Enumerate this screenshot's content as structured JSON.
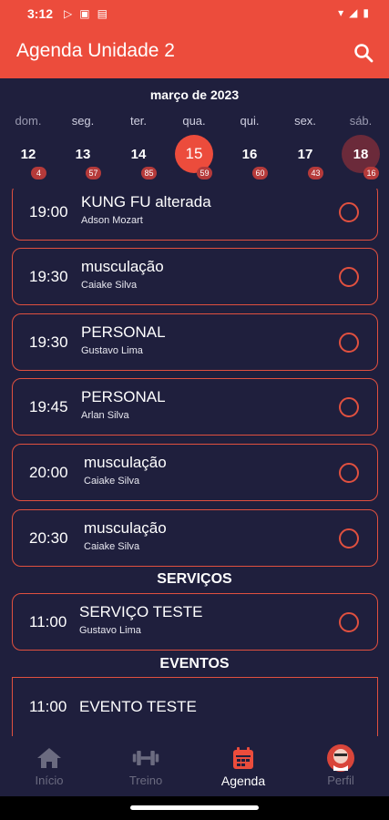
{
  "status_bar": {
    "time": "3:12"
  },
  "app_bar": {
    "title": "Agenda Unidade 2"
  },
  "calendar": {
    "month": "março de 2023",
    "days": [
      {
        "name": "dom.",
        "num": "12",
        "badge": "4",
        "state": "normal",
        "name_style": "faded"
      },
      {
        "name": "seg.",
        "num": "13",
        "badge": "57",
        "state": "normal",
        "name_style": "normal"
      },
      {
        "name": "ter.",
        "num": "14",
        "badge": "85",
        "state": "normal",
        "name_style": "normal"
      },
      {
        "name": "qua.",
        "num": "15",
        "badge": "59",
        "state": "today",
        "name_style": "normal"
      },
      {
        "name": "qui.",
        "num": "16",
        "badge": "60",
        "state": "normal",
        "name_style": "normal"
      },
      {
        "name": "sex.",
        "num": "17",
        "badge": "43",
        "state": "normal",
        "name_style": "normal"
      },
      {
        "name": "sáb.",
        "num": "18",
        "badge": "16",
        "state": "selected",
        "name_style": "faded"
      }
    ]
  },
  "appointments": [
    {
      "time": "19:00",
      "title": "KUNG FU alterada",
      "professional": "Adson Mozart"
    },
    {
      "time": "19:30",
      "title": "musculação",
      "professional": "Caiake Silva"
    },
    {
      "time": "19:30",
      "title": "PERSONAL",
      "professional": "Gustavo Lima"
    },
    {
      "time": "19:45",
      "title": "PERSONAL",
      "professional": "Arlan Silva"
    },
    {
      "time": "20:00",
      "title": "musculação",
      "professional": "Caiake Silva"
    },
    {
      "time": "20:30",
      "title": "musculação",
      "professional": "Caiake Silva"
    }
  ],
  "services": {
    "label": "SERVIÇOS",
    "items": [
      {
        "time": "11:00",
        "title": "SERVIÇO TESTE",
        "professional": "Gustavo Lima"
      }
    ]
  },
  "events": {
    "label": "EVENTOS",
    "items": [
      {
        "time": "11:00",
        "title": "EVENTO TESTE"
      }
    ]
  },
  "bottom_nav": {
    "items": [
      {
        "label": "Início",
        "icon": "home-icon"
      },
      {
        "label": "Treino",
        "icon": "dumbbell-icon"
      },
      {
        "label": "Agenda",
        "icon": "calendar-icon"
      },
      {
        "label": "Perfil",
        "icon": "avatar-icon"
      }
    ]
  },
  "colors": {
    "primary": "#ec4c3c",
    "background": "#1f1f3d",
    "selected_day": "#6b2a3a",
    "inactive_nav": "#6b6b80"
  }
}
